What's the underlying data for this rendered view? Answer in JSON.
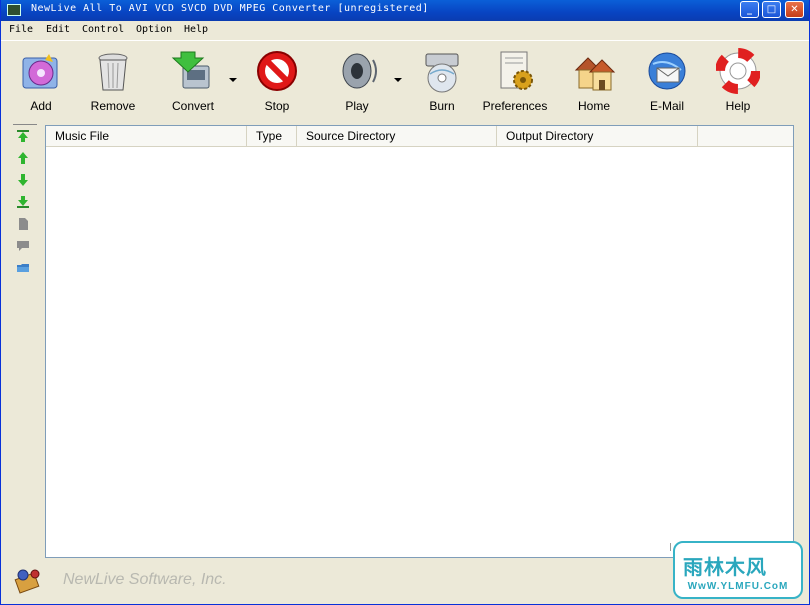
{
  "window": {
    "title": "NewLive All To AVI VCD SVCD DVD MPEG Converter  [unregistered]",
    "controls": {
      "minimize": "_",
      "maximize": "□",
      "close": "✕"
    }
  },
  "menu": [
    "File",
    "Edit",
    "Control",
    "Option",
    "Help"
  ],
  "toolbar": [
    {
      "label": "Add",
      "icon": "add-music-icon"
    },
    {
      "label": "Remove",
      "icon": "trash-can-icon"
    },
    {
      "label": "Convert",
      "icon": "convert-icon",
      "dropdown": true
    },
    {
      "label": "Stop",
      "icon": "stop-sign-icon"
    },
    {
      "label": "Play",
      "icon": "speaker-icon",
      "dropdown": true
    },
    {
      "label": "Burn",
      "icon": "disc-burn-icon"
    },
    {
      "label": "Preferences",
      "icon": "preferences-gear-icon"
    },
    {
      "label": "Home",
      "icon": "house-icon"
    },
    {
      "label": "E-Mail",
      "icon": "email-icon"
    },
    {
      "label": "Help",
      "icon": "lifebuoy-icon"
    }
  ],
  "sidebar_icons": [
    "move-top-icon",
    "move-up-icon",
    "move-down-icon",
    "move-bottom-icon",
    "file-icon",
    "comment-icon",
    "folder-icon"
  ],
  "list": {
    "columns": [
      "Music File",
      "Type",
      "Source Directory",
      "Output Directory"
    ],
    "rows": []
  },
  "status": {
    "company": "NewLive Software, Inc."
  },
  "watermark": {
    "brand": "雨林木风",
    "url": "WwW.YLMFU.CoM"
  },
  "colors": {
    "titlebar": "#0a54d0",
    "window_bg": "#ece9d8",
    "list_border": "#7f9db9",
    "watermark": "#2aa7bd"
  }
}
